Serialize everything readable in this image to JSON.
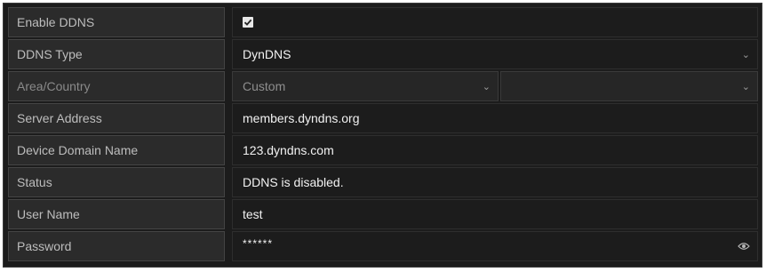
{
  "ddns": {
    "enable": {
      "label": "Enable DDNS",
      "checked": true
    },
    "type": {
      "label": "DDNS Type",
      "value": "DynDNS"
    },
    "area": {
      "label": "Area/Country",
      "value": "Custom",
      "secondary_value": ""
    },
    "server": {
      "label": "Server Address",
      "value": "members.dyndns.org"
    },
    "domain": {
      "label": "Device Domain Name",
      "value": "123.dyndns.com"
    },
    "status": {
      "label": "Status",
      "value": "DDNS is disabled."
    },
    "user": {
      "label": "User Name",
      "value": "test"
    },
    "password": {
      "label": "Password",
      "value": "******"
    }
  },
  "icons": {
    "chevron": "chevron-down-icon",
    "eye": "eye-icon",
    "check": "checkmark-icon"
  },
  "colors": {
    "panel_bg": "#1c1c1c",
    "label_bg": "#2b2b2b",
    "text": "#f2f2f2",
    "label_text": "#bdbdbd"
  }
}
